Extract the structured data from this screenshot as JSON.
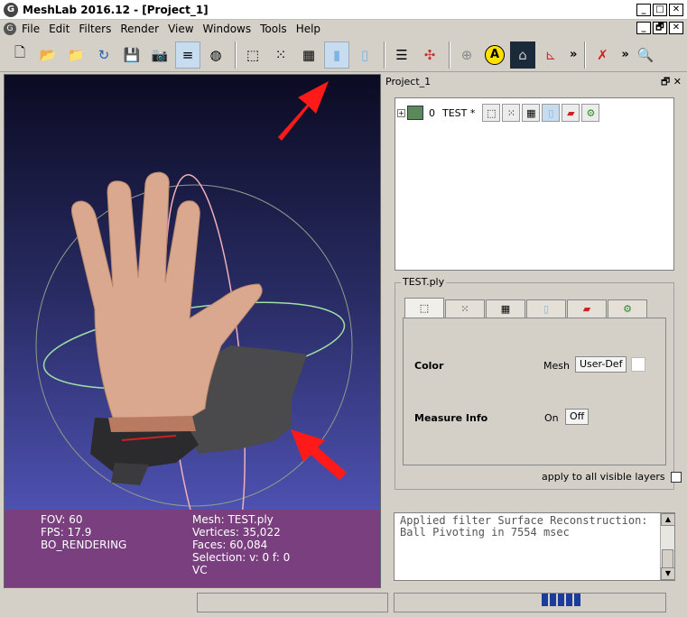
{
  "window": {
    "title": "MeshLab 2016.12 - [Project_1]",
    "app_glyph": "G"
  },
  "menu": {
    "items": [
      "File",
      "Edit",
      "Filters",
      "Render",
      "View",
      "Windows",
      "Tools",
      "Help"
    ]
  },
  "toolbar": {
    "more_glyph": "»",
    "buttons": [
      "new-doc",
      "open",
      "open-folder",
      "reload",
      "save",
      "snapshot",
      "layers",
      "sphere",
      "bbox",
      "points",
      "wireframe",
      "flat",
      "smooth",
      "layer-stack",
      "axis-transform",
      "sphere-grid",
      "annotation-a",
      "image-tower",
      "axes",
      "measure",
      "zoom"
    ],
    "annotation_letter": "A"
  },
  "viewport": {
    "info_left": [
      "FOV: 60",
      "FPS:   17.9",
      "BO_RENDERING"
    ],
    "info_right": [
      "Mesh: TEST.ply",
      "Vertices: 35,022",
      "Faces: 60,084",
      "Selection: v: 0 f: 0",
      "VC"
    ]
  },
  "layer_dock": {
    "title": "Project_1",
    "dock_icons": "🗗 ✕",
    "expand_glyph": "+",
    "layer": {
      "index": "0",
      "name": "TEST *"
    }
  },
  "props": {
    "group_title": "TEST.ply",
    "color": {
      "label": "Color",
      "prefix": "Mesh",
      "value": "User-Def"
    },
    "measure": {
      "label": "Measure Info",
      "prefix": "On",
      "value": "Off"
    },
    "apply_label": "apply to all visible layers"
  },
  "log": {
    "text": "Applied filter Surface Reconstruction: Ball Pivoting in 7554 msec"
  },
  "colors": {
    "info_panel": "#7a3f7e",
    "arrow": "#ff1a1a",
    "progress": "#1c3c9c"
  }
}
